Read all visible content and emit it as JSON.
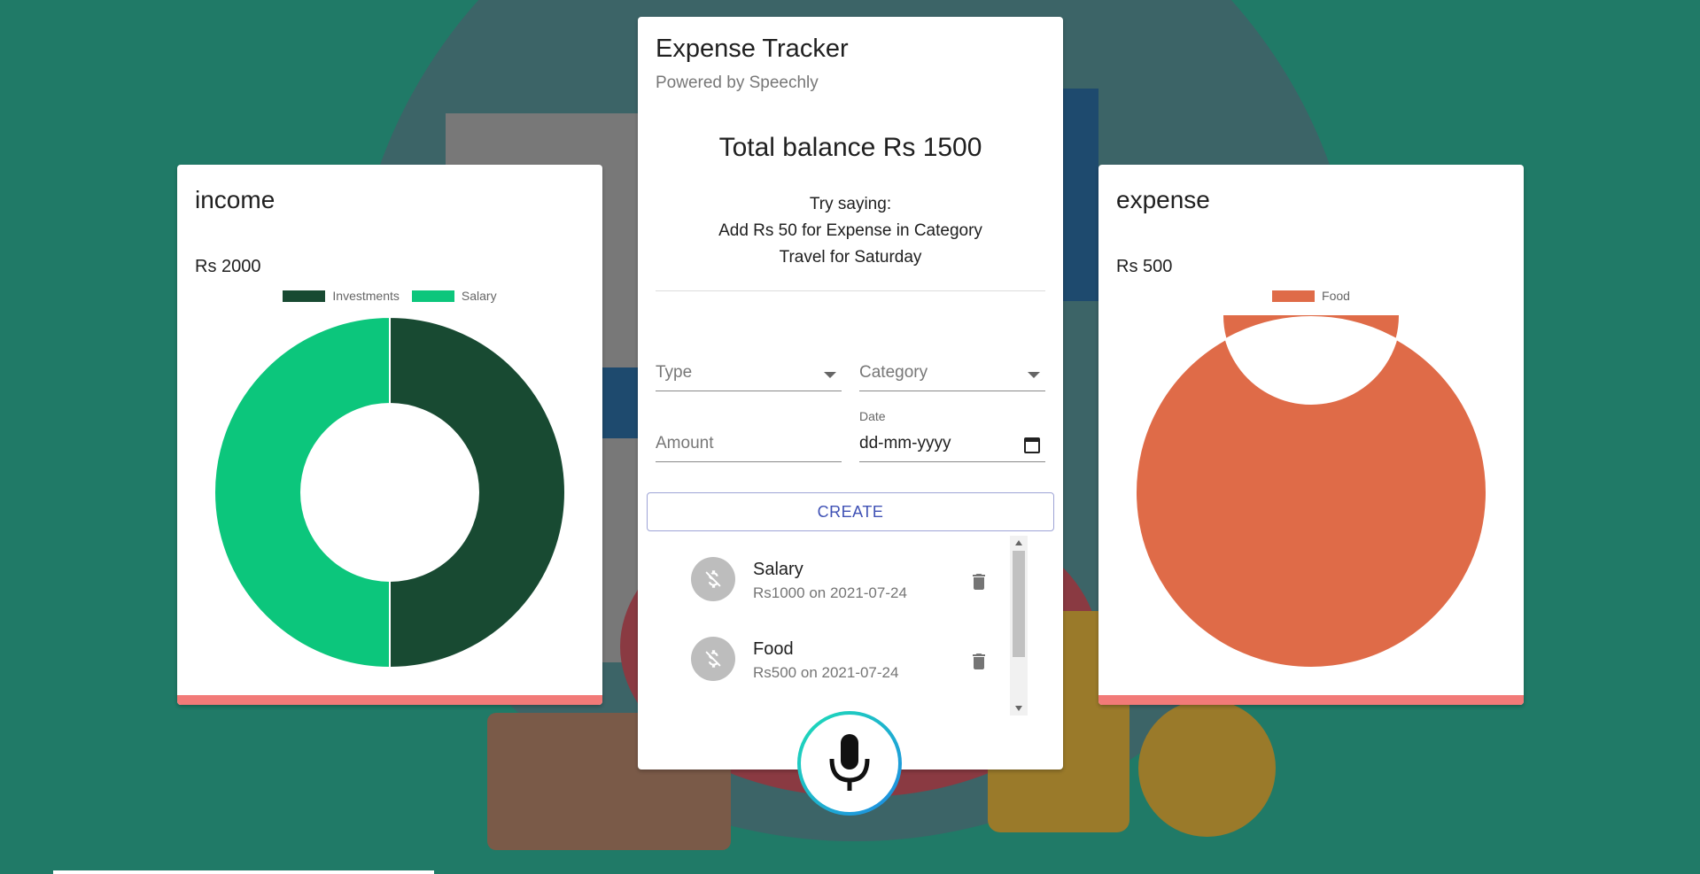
{
  "colors": {
    "background": "#207a67",
    "investments": "#184a32",
    "salary": "#0cc67c",
    "food": "#df6b48",
    "accent": "#3f51b5",
    "strip": "#f27a78"
  },
  "income": {
    "title": "income",
    "total": "Rs 2000",
    "chart_data": {
      "type": "pie",
      "categories": [
        "Investments",
        "Salary"
      ],
      "values": [
        1000,
        1000
      ],
      "legend": "top"
    }
  },
  "expense": {
    "title": "expense",
    "total": "Rs 500",
    "chart_data": {
      "type": "pie",
      "categories": [
        "Food"
      ],
      "values": [
        500
      ],
      "legend": "top"
    }
  },
  "tracker": {
    "title": "Expense Tracker",
    "subtitle": "Powered by Speechly",
    "balance": "Total balance Rs 1500",
    "hint_line1": "Try saying:",
    "hint_line2": "Add Rs 50 for Expense in Category",
    "hint_line3": "Travel for Saturday",
    "type_placeholder": "Type",
    "category_placeholder": "Category",
    "amount_placeholder": "Amount",
    "date_label": "Date",
    "date_value": "dd-mm-yyyy",
    "create_label": "CREATE",
    "transactions": [
      {
        "title": "Salary",
        "subtitle": "Rs1000 on 2021-07-24"
      },
      {
        "title": "Food",
        "subtitle": "Rs500 on 2021-07-24"
      }
    ]
  },
  "icons": {
    "transaction": "money-off-icon",
    "delete": "trash-icon",
    "mic": "microphone-icon",
    "calendar": "calendar-icon"
  }
}
